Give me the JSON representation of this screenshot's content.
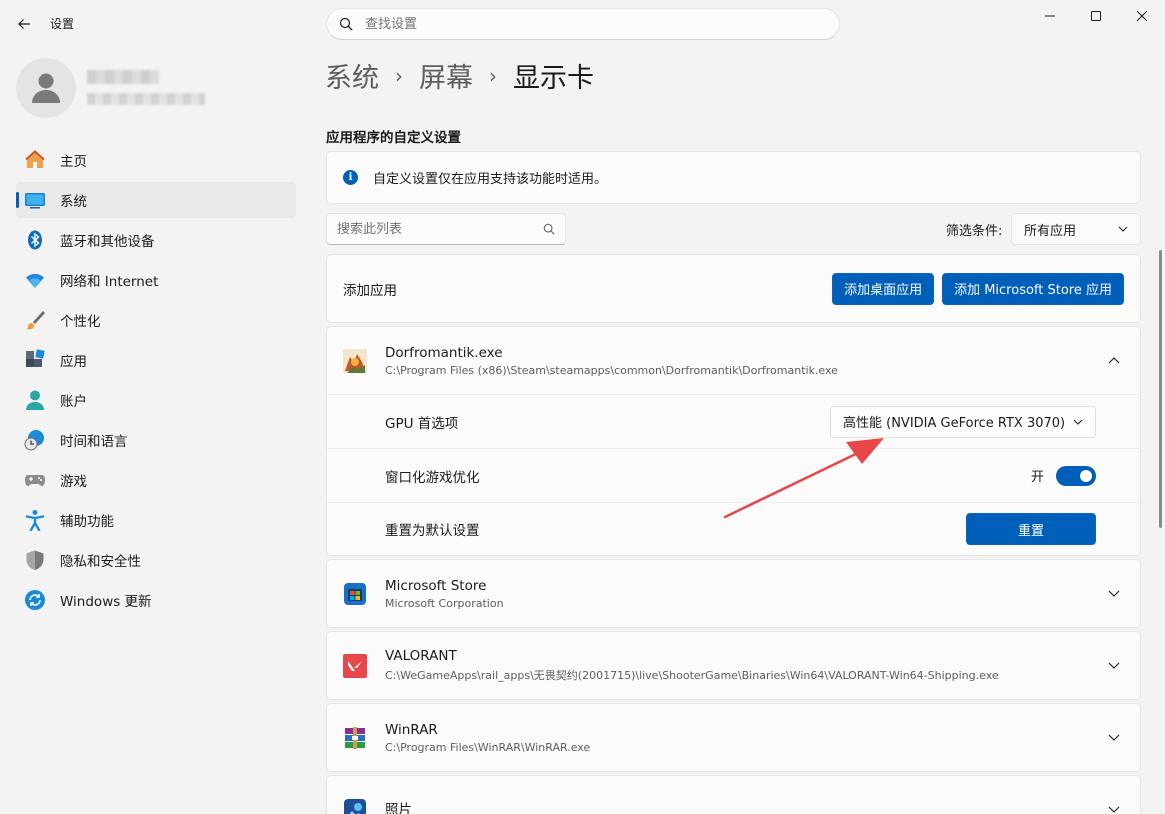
{
  "window": {
    "title": "设置"
  },
  "search": {
    "placeholder": "查找设置"
  },
  "sidebar": {
    "items": [
      {
        "label": "主页",
        "icon": "home-icon"
      },
      {
        "label": "系统",
        "icon": "system-icon",
        "active": true
      },
      {
        "label": "蓝牙和其他设备",
        "icon": "bluetooth-icon"
      },
      {
        "label": "网络和 Internet",
        "icon": "wifi-icon"
      },
      {
        "label": "个性化",
        "icon": "brush-icon"
      },
      {
        "label": "应用",
        "icon": "apps-icon"
      },
      {
        "label": "账户",
        "icon": "account-icon"
      },
      {
        "label": "时间和语言",
        "icon": "time-language-icon"
      },
      {
        "label": "游戏",
        "icon": "gamepad-icon"
      },
      {
        "label": "辅助功能",
        "icon": "accessibility-icon"
      },
      {
        "label": "隐私和安全性",
        "icon": "shield-icon"
      },
      {
        "label": "Windows 更新",
        "icon": "update-icon"
      }
    ]
  },
  "breadcrumb": {
    "items": [
      "系统",
      "屏幕"
    ],
    "current": "显示卡"
  },
  "section": {
    "title": "应用程序的自定义设置",
    "info": "自定义设置仅在应用支持该功能时适用。"
  },
  "list_search": {
    "placeholder": "搜索此列表"
  },
  "filter": {
    "label": "筛选条件:",
    "value": "所有应用"
  },
  "add_app": {
    "label": "添加应用",
    "desktop_button": "添加桌面应用",
    "store_button": "添加 Microsoft Store 应用"
  },
  "expanded_app": {
    "name": "Dorfromantik.exe",
    "path": "C:\\Program Files (x86)\\Steam\\steamapps\\common\\Dorfromantik\\Dorfromantik.exe",
    "gpu_label": "GPU 首选项",
    "gpu_value": "高性能 (NVIDIA GeForce RTX 3070)",
    "windowed_label": "窗口化游戏优化",
    "windowed_state": "开",
    "reset_label": "重置为默认设置",
    "reset_button": "重置"
  },
  "apps": [
    {
      "name": "Microsoft Store",
      "path": "Microsoft Corporation"
    },
    {
      "name": "VALORANT",
      "path": "C:\\WeGameApps\\rail_apps\\无畏契约(2001715)\\live\\ShooterGame\\Binaries\\Win64\\VALORANT-Win64-Shipping.exe"
    },
    {
      "name": "WinRAR",
      "path": "C:\\Program Files\\WinRAR\\WinRAR.exe"
    },
    {
      "name": "照片",
      "path": ""
    }
  ],
  "colors": {
    "accent": "#005fb8",
    "annotation_arrow": "#e8474a"
  }
}
